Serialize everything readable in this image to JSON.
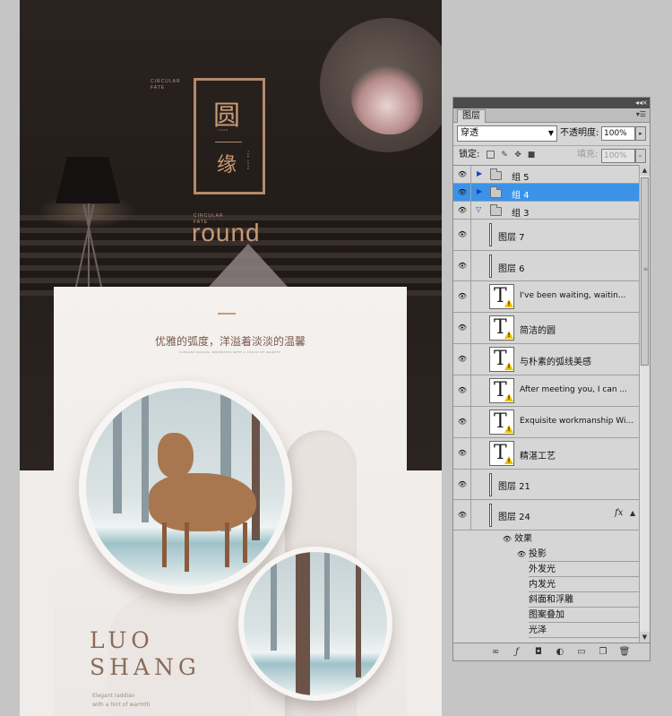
{
  "artwork": {
    "hero": {
      "small_caption_1": [
        "CIRCULAR",
        "FATE"
      ],
      "tag_char_top": "圆",
      "tag_char_bottom": "缘",
      "tag_tiny_left": "YUAN",
      "tag_tiny_right": "THE FATE",
      "small_caption_2": [
        "CIRCULAR",
        "FATE"
      ],
      "round_word": "round"
    },
    "product": {
      "cn_slogan": "优雅的弧度，洋溢着淡淡的温馨",
      "en_slogan": "ELEGANT RADIAN, PERMEATES WITH A TOUCH OF WARMTH",
      "brand_line1": "LUO",
      "brand_line2": "SHANG",
      "brand_sub_line1": "Elegant raddian",
      "brand_sub_line2": "with a hint of warmth"
    }
  },
  "layers_panel": {
    "tab_label": "图层",
    "blend_mode": "穿透",
    "opacity_label": "不透明度:",
    "opacity_value": "100%",
    "lock_label": "锁定:",
    "fill_label": "填充:",
    "fill_value": "100%",
    "layers": [
      {
        "name": "组 5",
        "kind": "group",
        "expanded": false,
        "selected": false
      },
      {
        "name": "组 4",
        "kind": "group",
        "expanded": false,
        "selected": true
      },
      {
        "name": "组 3",
        "kind": "group",
        "expanded": true,
        "selected": false
      },
      {
        "name": "图层 7",
        "kind": "pixel"
      },
      {
        "name": "图层 6",
        "kind": "pixel"
      },
      {
        "name": "I've been  waiting, waitin...",
        "kind": "text"
      },
      {
        "name": "简洁的圆",
        "kind": "text"
      },
      {
        "name": "与朴素的弧线美感",
        "kind": "text"
      },
      {
        "name": "After meeting you, I can ...",
        "kind": "text"
      },
      {
        "name": "Exquisite workmanship Wi...",
        "kind": "text"
      },
      {
        "name": "精湛工艺",
        "kind": "text"
      },
      {
        "name": "图层 21",
        "kind": "pixel"
      },
      {
        "name": "图层 24",
        "kind": "pixel",
        "fx": "fx"
      }
    ],
    "effects_label": "效果",
    "effects": [
      "投影",
      "外发光",
      "内发光",
      "斜面和浮雕",
      "图案叠加",
      "光泽"
    ],
    "colors": {
      "selection": "#3b93e8",
      "warning": "#f2c200"
    }
  }
}
